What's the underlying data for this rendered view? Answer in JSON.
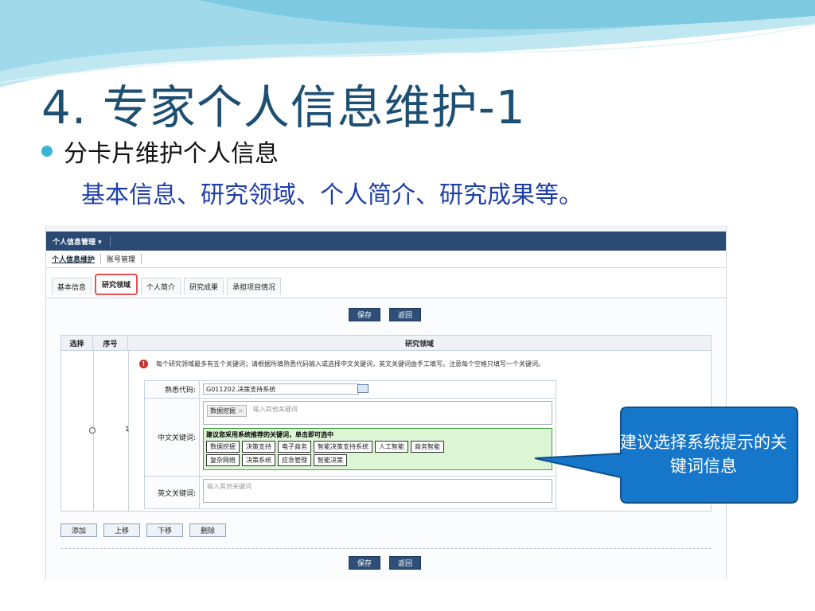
{
  "slide": {
    "title": "4. 专家个人信息维护-1",
    "bullet": "分卡片维护个人信息",
    "subtext": "基本信息、研究领域、个人简介、研究成果等。",
    "callout": "建议选择系统提示的关键词信息"
  },
  "app": {
    "topbar": {
      "menu_label": "个人信息管理 ▾"
    },
    "subnav": {
      "active": "个人信息维护",
      "item2": "账号管理"
    },
    "tabs": [
      "基本信息",
      "研究领域",
      "个人简介",
      "研究成果",
      "承担项目情况"
    ],
    "buttons": {
      "save": "保存",
      "back": "返回"
    },
    "grid": {
      "headers": {
        "select": "选择",
        "seq": "序号",
        "field": "研究领域"
      },
      "row_seq": "1"
    },
    "info": "每个研究领域最多有五个关键词；请根据所填熟悉代码输入或选择中文关键词，英文关键词由手工填写。注意每个空格只填写一个关键词。",
    "form": {
      "code_label": "熟悉代码:",
      "code_value": "G011202.决策支持系统",
      "cn_label": "中文关键词:",
      "cn_tag": "数据挖掘",
      "cn_placeholder": "输入其他关键词",
      "suggest_title": "建议您采用系统推荐的关键词，单击即可选中",
      "keywords_row1": [
        "数据挖掘",
        "决策支持",
        "电子商务",
        "智能决策支持系统",
        "人工智能",
        "商务智能"
      ],
      "keywords_row2": [
        "复杂网络",
        "决策系统",
        "应急管理",
        "智能决策"
      ],
      "en_label": "英文关键词:",
      "en_placeholder": "输入其他关键词"
    },
    "row_actions": {
      "add": "添加",
      "up": "上移",
      "down": "下移",
      "delete": "删除"
    }
  }
}
